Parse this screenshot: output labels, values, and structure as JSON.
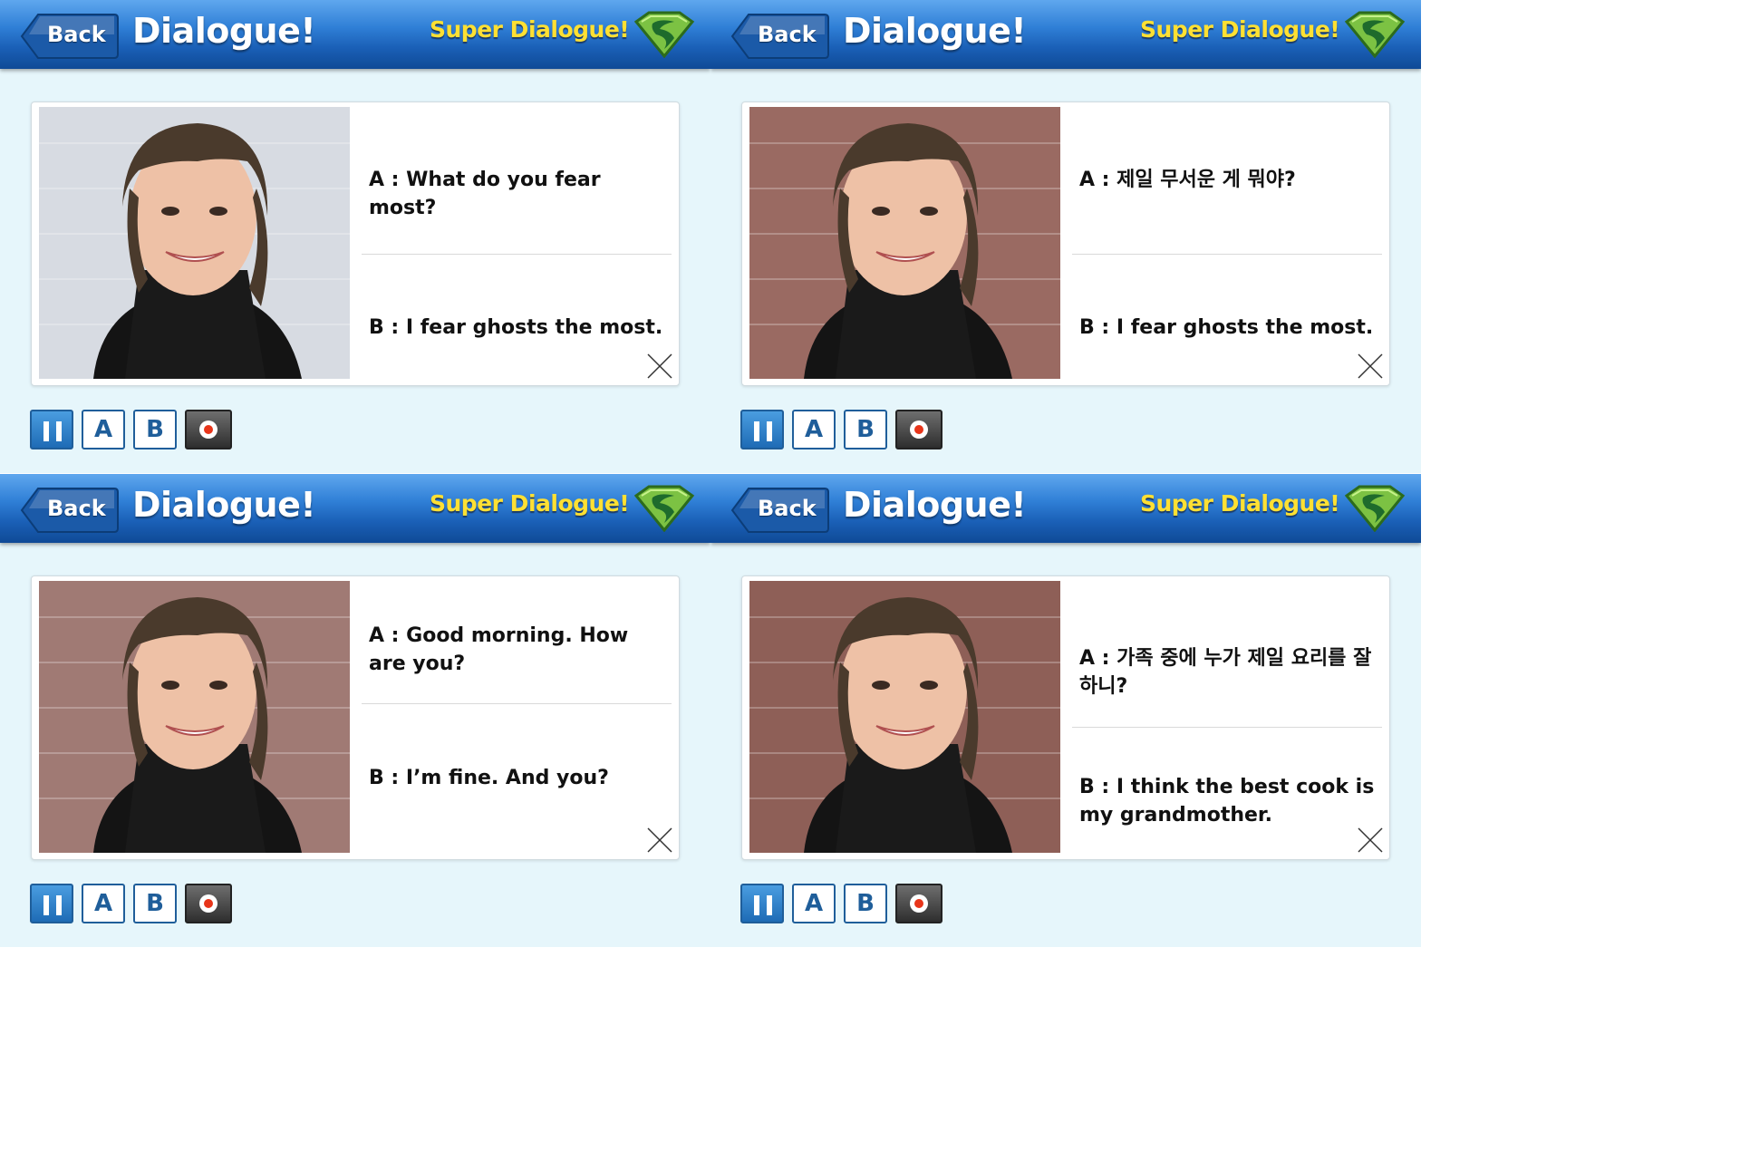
{
  "colors": {
    "background": "#e6f6fb",
    "header_blue": "#1a5fb6",
    "super_yellow": "#ffe033",
    "control_blue": "#1f5e9a",
    "record_red": "#e8351a"
  },
  "panels": [
    {
      "header": {
        "back_label": "Back",
        "title": "Dialogue!",
        "super_label": "Super Dialogue!",
        "super_icon": "superman-shield-icon"
      },
      "photo": {
        "description_icon": "portrait-photo",
        "bg": "#d7dbe2"
      },
      "dialogue": {
        "a": "A : What do you fear most?",
        "b": "B : I fear ghosts the most."
      },
      "controls": {
        "pause_icon": "pause-icon",
        "a_label": "A",
        "b_label": "B",
        "record_icon": "record-icon"
      }
    },
    {
      "header": {
        "back_label": "Back",
        "title": "Dialogue!",
        "super_label": "Super Dialogue!",
        "super_icon": "superman-shield-icon"
      },
      "photo": {
        "description_icon": "portrait-photo",
        "bg": "#9a6a62"
      },
      "dialogue": {
        "a": "A : 제일 무서운 게 뭐야?",
        "b": "B : I fear ghosts the most."
      },
      "controls": {
        "pause_icon": "pause-icon",
        "a_label": "A",
        "b_label": "B",
        "record_icon": "record-icon"
      }
    },
    {
      "header": {
        "back_label": "Back",
        "title": "Dialogue!",
        "super_label": "Super Dialogue!",
        "super_icon": "superman-shield-icon"
      },
      "photo": {
        "description_icon": "portrait-photo",
        "bg": "#a07a74"
      },
      "dialogue": {
        "a": "A :  Good morning. How are you?",
        "b": "B :  I’m fine. And you?"
      },
      "controls": {
        "pause_icon": "pause-icon",
        "a_label": "A",
        "b_label": "B",
        "record_icon": "record-icon"
      }
    },
    {
      "header": {
        "back_label": "Back",
        "title": "Dialogue!",
        "super_label": "Super Dialogue!",
        "super_icon": "superman-shield-icon"
      },
      "photo": {
        "description_icon": "portrait-photo",
        "bg": "#8e5f57"
      },
      "dialogue": {
        "a": "A : 가족 중에 누가 제일 요리를 잘 하니?",
        "b": "B : I think the best cook is my grandmother."
      },
      "controls": {
        "pause_icon": "pause-icon",
        "a_label": "A",
        "b_label": "B",
        "record_icon": "record-icon"
      }
    }
  ]
}
